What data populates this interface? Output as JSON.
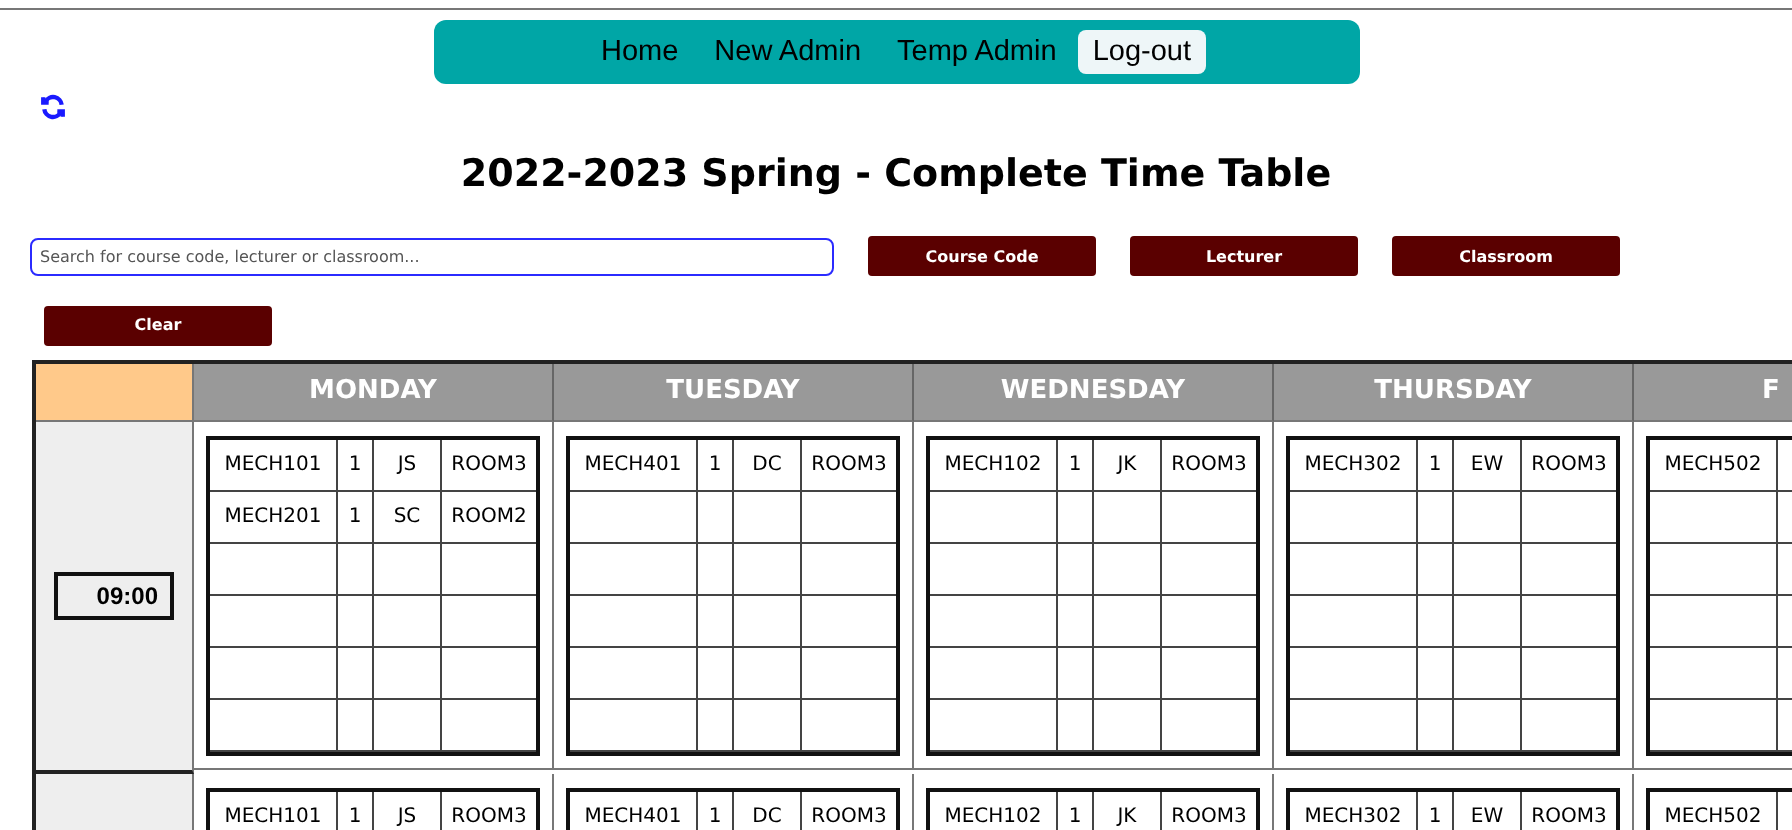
{
  "nav": [
    {
      "label": "Home",
      "selected": false
    },
    {
      "label": "New Admin",
      "selected": false
    },
    {
      "label": "Temp Admin",
      "selected": false
    },
    {
      "label": "Log-out",
      "selected": true
    }
  ],
  "title": "2022-2023 Spring - Complete Time Table",
  "search": {
    "placeholder": "Search for course code, lecturer or classroom..."
  },
  "filter_buttons": [
    "Course Code",
    "Lecturer",
    "Classroom"
  ],
  "clear_button": "Clear",
  "days": [
    "MONDAY",
    "TUESDAY",
    "WEDNESDAY",
    "THURSDAY",
    "F"
  ],
  "slots": [
    {
      "time": "09:00",
      "days": [
        {
          "entries": [
            {
              "code": "MECH101",
              "section": "1",
              "lecturer": "JS",
              "room": "ROOM3"
            },
            {
              "code": "MECH201",
              "section": "1",
              "lecturer": "SC",
              "room": "ROOM2"
            }
          ]
        },
        {
          "entries": [
            {
              "code": "MECH401",
              "section": "1",
              "lecturer": "DC",
              "room": "ROOM3"
            }
          ]
        },
        {
          "entries": [
            {
              "code": "MECH102",
              "section": "1",
              "lecturer": "JK",
              "room": "ROOM3"
            }
          ]
        },
        {
          "entries": [
            {
              "code": "MECH302",
              "section": "1",
              "lecturer": "EW",
              "room": "ROOM3"
            }
          ]
        },
        {
          "entries": [
            {
              "code": "MECH502"
            }
          ]
        }
      ]
    },
    {
      "days": [
        {
          "entries": [
            {
              "code": "MECH101",
              "section": "1",
              "lecturer": "JS",
              "room": "ROOM3"
            }
          ]
        },
        {
          "entries": [
            {
              "code": "MECH401",
              "section": "1",
              "lecturer": "DC",
              "room": "ROOM3"
            }
          ]
        },
        {
          "entries": [
            {
              "code": "MECH102",
              "section": "1",
              "lecturer": "JK",
              "room": "ROOM3"
            }
          ]
        },
        {
          "entries": [
            {
              "code": "MECH302",
              "section": "1",
              "lecturer": "EW",
              "room": "ROOM3"
            }
          ]
        },
        {
          "entries": [
            {
              "code": "MECH502"
            }
          ]
        }
      ]
    }
  ]
}
